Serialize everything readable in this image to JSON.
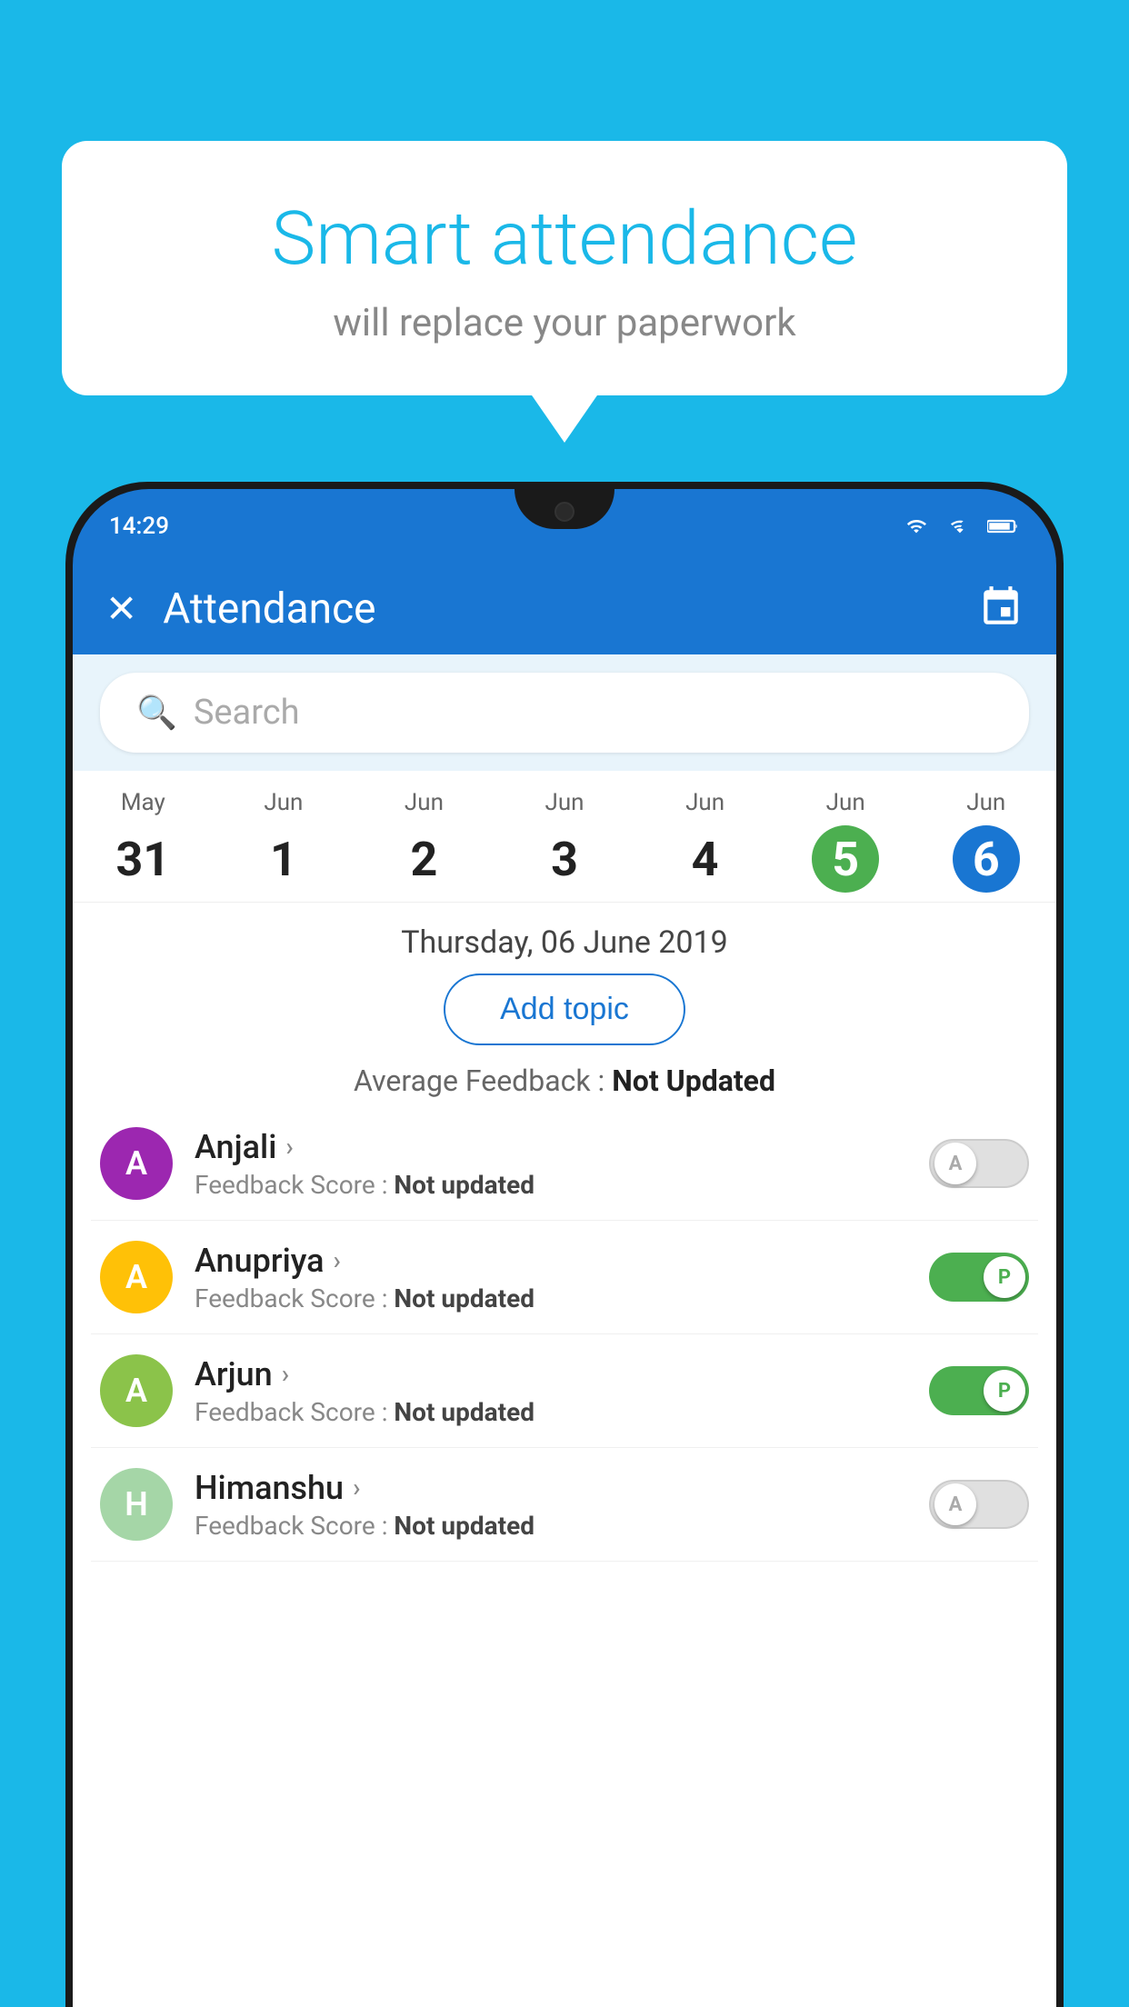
{
  "background_color": "#1ab8e8",
  "speech_bubble": {
    "title": "Smart attendance",
    "subtitle": "will replace your paperwork"
  },
  "status_bar": {
    "time": "14:29"
  },
  "header": {
    "title": "Attendance",
    "close_label": "✕"
  },
  "search": {
    "placeholder": "Search"
  },
  "calendar": {
    "days": [
      {
        "month": "May",
        "num": "31",
        "state": "normal"
      },
      {
        "month": "Jun",
        "num": "1",
        "state": "normal"
      },
      {
        "month": "Jun",
        "num": "2",
        "state": "normal"
      },
      {
        "month": "Jun",
        "num": "3",
        "state": "normal"
      },
      {
        "month": "Jun",
        "num": "4",
        "state": "normal"
      },
      {
        "month": "Jun",
        "num": "5",
        "state": "today"
      },
      {
        "month": "Jun",
        "num": "6",
        "state": "selected"
      }
    ]
  },
  "selected_date": "Thursday, 06 June 2019",
  "add_topic_label": "Add topic",
  "avg_feedback_label": "Average Feedback : ",
  "avg_feedback_value": "Not Updated",
  "students": [
    {
      "name": "Anjali",
      "avatar_letter": "A",
      "avatar_color": "#9c27b0",
      "feedback_label": "Feedback Score : ",
      "feedback_value": "Not updated",
      "toggle": "off",
      "toggle_letter": "A"
    },
    {
      "name": "Anupriya",
      "avatar_letter": "A",
      "avatar_color": "#ffc107",
      "feedback_label": "Feedback Score : ",
      "feedback_value": "Not updated",
      "toggle": "on",
      "toggle_letter": "P"
    },
    {
      "name": "Arjun",
      "avatar_letter": "A",
      "avatar_color": "#8bc34a",
      "feedback_label": "Feedback Score : ",
      "feedback_value": "Not updated",
      "toggle": "on",
      "toggle_letter": "P"
    },
    {
      "name": "Himanshu",
      "avatar_letter": "H",
      "avatar_color": "#a5d6a7",
      "feedback_label": "Feedback Score : ",
      "feedback_value": "Not updated",
      "toggle": "off",
      "toggle_letter": "A"
    }
  ]
}
